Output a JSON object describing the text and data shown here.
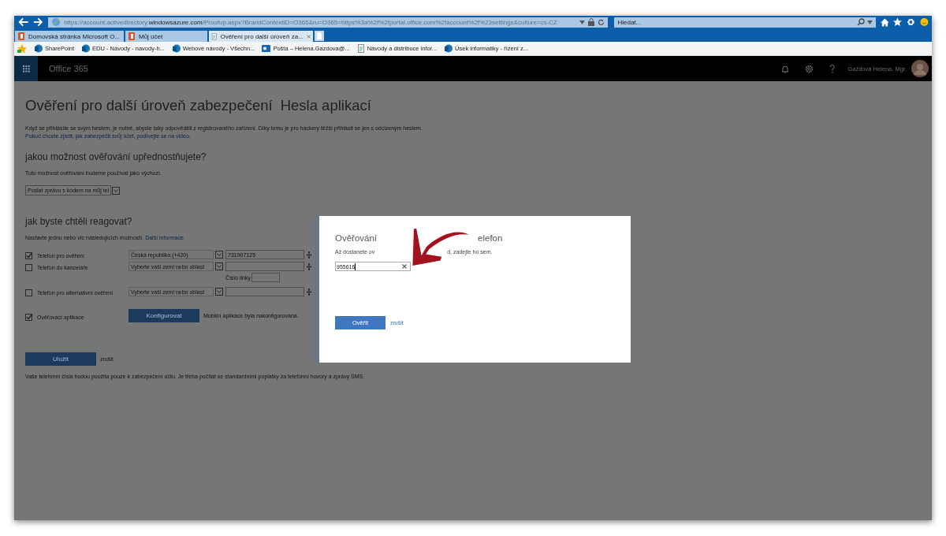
{
  "browser": {
    "url": "https://account.activedirectory.**windowsazure.com**/Proofup.aspx?BrandContextID=O365&ru=O365=https%3a%2f%2fportal.office.com%2faccount%2f%23settings&culture=cs-CZ",
    "search": {
      "placeholder": "Hledat..."
    },
    "tabs": [
      {
        "label": "Domovská stránka Microsoft O...",
        "kind": "office",
        "selected": false
      },
      {
        "label": "Můj účet",
        "kind": "office",
        "selected": false
      },
      {
        "label": "Ověření pro další úroveň za...",
        "kind": "page",
        "selected": true
      }
    ],
    "favorites": [
      {
        "label": "SharePoint",
        "kind": "sharepoint"
      },
      {
        "label": "EDU - Návody - navody-h...",
        "kind": "sharepoint"
      },
      {
        "label": "Webové návody - Všechn...",
        "kind": "sharepoint"
      },
      {
        "label": "Pošta – Helena.Gazdova@...",
        "kind": "outlook"
      },
      {
        "label": "Návody a distribuce infor...",
        "kind": "page"
      },
      {
        "label": "Úsek informatiky - řízení z...",
        "kind": "sharepoint"
      }
    ]
  },
  "app_bar": {
    "title": "Office 365",
    "user": "Gaždová Helena, Mgr."
  },
  "page": {
    "title": "Ověření pro další úroveň zabezpečení",
    "title_tab": "Hesla aplikací",
    "intro": "Když se přihlásíte se svým heslem, je nutné, abyste taky odpověděli z registrovaného zařízení. Díky tomu je pro hackery těžší přihlásit se jen s odcizeným heslem.",
    "intro_link": "Pokud chcete zjistit, jak zabezpečit svůj účet, podívejte se na video.",
    "preferred": {
      "heading": "jakou možnost ověřování upřednostňujete?",
      "note": "Tuto možnost ověřování budeme používat jako výchozí.",
      "select": "Poslat zprávu s kódem na můj tel"
    },
    "respond": {
      "heading": "jak byste chtěli reagovat?",
      "note": "Nastavte jednu nebo víc následujících možností.",
      "link": "Další informace"
    },
    "options": [
      {
        "kind": "phone",
        "checked": true,
        "label": "Telefon pro ověření",
        "country": "Česká republika (+420)",
        "number": "731907125"
      },
      {
        "kind": "phone",
        "checked": false,
        "label": "Telefon do kanceláře",
        "country": "Vyberte vaši zemi nebo oblast",
        "extension_label": "Číslo linky"
      },
      {
        "kind": "phone",
        "checked": false,
        "label": "Telefon pro alternativní ověření",
        "country": "Vyberte vaši zemi nebo oblast"
      },
      {
        "kind": "app",
        "checked": true,
        "label": "Ověřovací aplikace",
        "button": "Konfigurovat",
        "status": "Mobilní aplikace byla nakonfigurována."
      }
    ],
    "save": "Uložit",
    "cancel": "zrušit",
    "footer": "Vaše telefonní čísla budou použita pouze k zabezpečení účtu. Je třeba počítat se standardními poplatky za telefonní hovory a zprávy SMS."
  },
  "dialog": {
    "title": [
      "Ověřování",
      "elefon"
    ],
    "text": [
      "Až dostanete ov",
      "d, zadejte ho sem."
    ],
    "code": "955616",
    "verify": "Ověřit",
    "cancel": "zrušit"
  }
}
